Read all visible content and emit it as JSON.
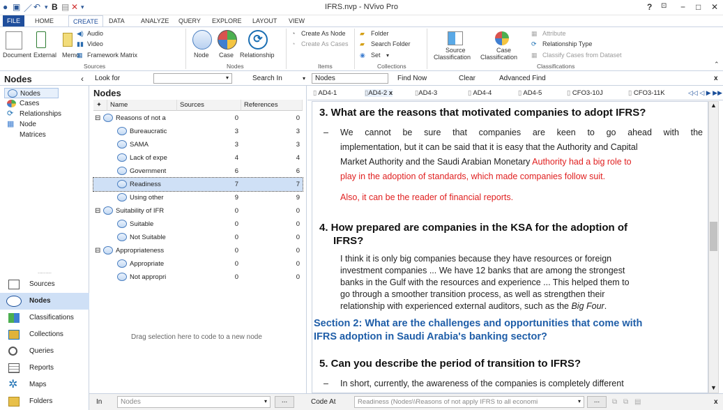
{
  "window": {
    "title": "IFRS.nvp - NVivo Pro",
    "help": "?"
  },
  "tabs": [
    "FILE",
    "HOME",
    "CREATE",
    "DATA",
    "ANALYZE",
    "QUERY",
    "EXPLORE",
    "LAYOUT",
    "VIEW"
  ],
  "ribbon": {
    "sources_group": {
      "label": "Sources",
      "document": "Document",
      "external": "External",
      "memo": "Memo",
      "audio": "Audio",
      "video": "Video",
      "framework_matrix": "Framework Matrix"
    },
    "nodes_group": {
      "label": "Nodes",
      "node": "Node",
      "case": "Case",
      "relationship": "Relationship"
    },
    "items_group": {
      "label": "Items",
      "create_as_node": "Create As Node",
      "create_as_cases": "Create As Cases"
    },
    "collections_group": {
      "label": "Collections",
      "folder": "Folder",
      "search_folder": "Search Folder",
      "set": "Set"
    },
    "classifications_group": {
      "label": "Classifications",
      "source_classification_1": "Source",
      "source_classification_2": "Classification",
      "case_classification_1": "Case",
      "case_classification_2": "Classification",
      "attribute": "Attribute",
      "relationship_type": "Relationship Type",
      "classify_cases": "Classify Cases from Dataset"
    }
  },
  "nav": {
    "title": "Nodes",
    "tree": [
      "Nodes",
      "Cases",
      "Relationships",
      "Node Matrices"
    ],
    "dots": "........."
  },
  "workspace": [
    "Sources",
    "Nodes",
    "Classifications",
    "Collections",
    "Queries",
    "Reports",
    "Maps",
    "Folders"
  ],
  "findbar": {
    "look_for": "Look for",
    "search_in": "Search In",
    "search_in_value": "Nodes",
    "find_now": "Find Now",
    "clear": "Clear",
    "advanced_find": "Advanced Find"
  },
  "list": {
    "title": "Nodes",
    "columns": [
      "Name",
      "Sources",
      "References"
    ],
    "rows": [
      {
        "name": "Reasons of not a",
        "sources": "0",
        "refs": "0",
        "level": 0,
        "expand": "−"
      },
      {
        "name": "Bureaucratic",
        "sources": "3",
        "refs": "3",
        "level": 1
      },
      {
        "name": "SAMA",
        "sources": "3",
        "refs": "3",
        "level": 1
      },
      {
        "name": "Lack of expe",
        "sources": "4",
        "refs": "4",
        "level": 1
      },
      {
        "name": "Government",
        "sources": "6",
        "refs": "6",
        "level": 1
      },
      {
        "name": "Readiness",
        "sources": "7",
        "refs": "7",
        "level": 1,
        "selected": true
      },
      {
        "name": "Using other",
        "sources": "9",
        "refs": "9",
        "level": 1
      },
      {
        "name": "Suitability of IFR",
        "sources": "0",
        "refs": "0",
        "level": 0,
        "expand": "−"
      },
      {
        "name": "Suitable",
        "sources": "0",
        "refs": "0",
        "level": 1
      },
      {
        "name": "Not Suitable",
        "sources": "0",
        "refs": "0",
        "level": 1
      },
      {
        "name": "Appropriateness",
        "sources": "0",
        "refs": "0",
        "level": 0,
        "expand": "−"
      },
      {
        "name": "Appropriate",
        "sources": "0",
        "refs": "0",
        "level": 1
      },
      {
        "name": "Not appropri",
        "sources": "0",
        "refs": "0",
        "level": 1
      }
    ],
    "drop_hint": "Drag selection here to code to a new node"
  },
  "doc": {
    "tabs": [
      "AD4-1",
      "AD4-2",
      "AD4-3",
      "AD4-4",
      "AD4-5",
      "CFO3-10J",
      "CFO3-11K"
    ],
    "tab_close": "x",
    "q3": "3. What are the reasons that motivated companies to adopt IFRS?",
    "q3_p1a": "We cannot be sure that companies are keen to go ahead with the",
    "q3_p1b": "implementation, but it can be said that it is easy that the Authority and Capital",
    "q3_p1c": "Market Authority and the Saudi Arabian Monetary ",
    "q3_p1c_red": "Authority had a big role to",
    "q3_p1d_red": "play in the adoption of standards, which made companies follow suit.",
    "q3_p2_red": "Also, it can be the reader of financial reports.",
    "q4a": "4. How prepared are companies in the KSA for the adoption of",
    "q4b": "IFRS?",
    "q4_p1": "I think it is only big companies because they have resources or foreign",
    "q4_p2": "investment companies ... We have 12 banks that are among the strongest",
    "q4_p3": "banks in the Gulf with the resources and experience ... This helped them to",
    "q4_p4": "go through a smoother transition process, as well as strengthen their",
    "q4_p5": "relationship with experienced external auditors, such as the ",
    "q4_p5_it": "Big Four",
    "sec2a": "Section 2: What are the challenges and opportunities that come with",
    "sec2b": "IFRS adoption in Saudi Arabia's banking sector?",
    "q5": "5. Can you describe the period of transition to IFRS?",
    "q5_p1": "In short, currently, the awareness of the companies is completely different"
  },
  "status": {
    "in": "In",
    "in_value": "Nodes",
    "code_at": "Code At",
    "code_at_value": "Readiness (Nodes\\\\Reasons of not apply IFRS to all economi",
    "ellipsis": "..."
  },
  "colors": {
    "accent": "#1f4e9c",
    "selected": "#cfe0f6",
    "red_text": "#e02020",
    "section": "#1f5ea8"
  }
}
